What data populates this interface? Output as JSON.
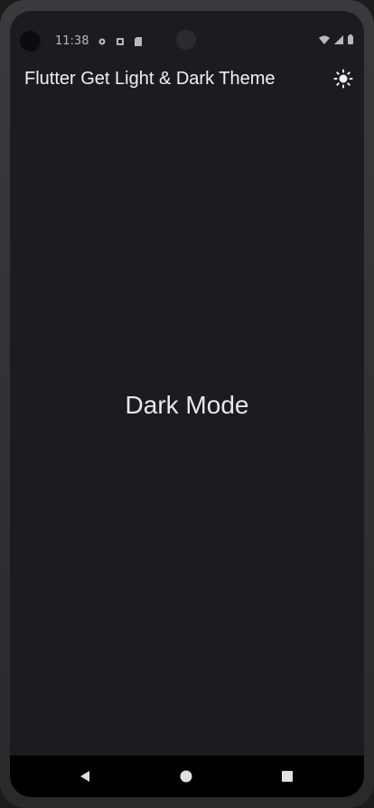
{
  "status_bar": {
    "time": "11:38"
  },
  "app_bar": {
    "title": "Flutter Get Light & Dark Theme",
    "action_icon": "sun-icon"
  },
  "body": {
    "mode_text": "Dark Mode"
  },
  "nav_bar": {
    "back_icon": "back-triangle-icon",
    "home_icon": "home-circle-icon",
    "recents_icon": "recents-square-icon"
  },
  "colors": {
    "background": "#1d1b20",
    "text": "#e9e7ec",
    "nav": "#000000"
  }
}
